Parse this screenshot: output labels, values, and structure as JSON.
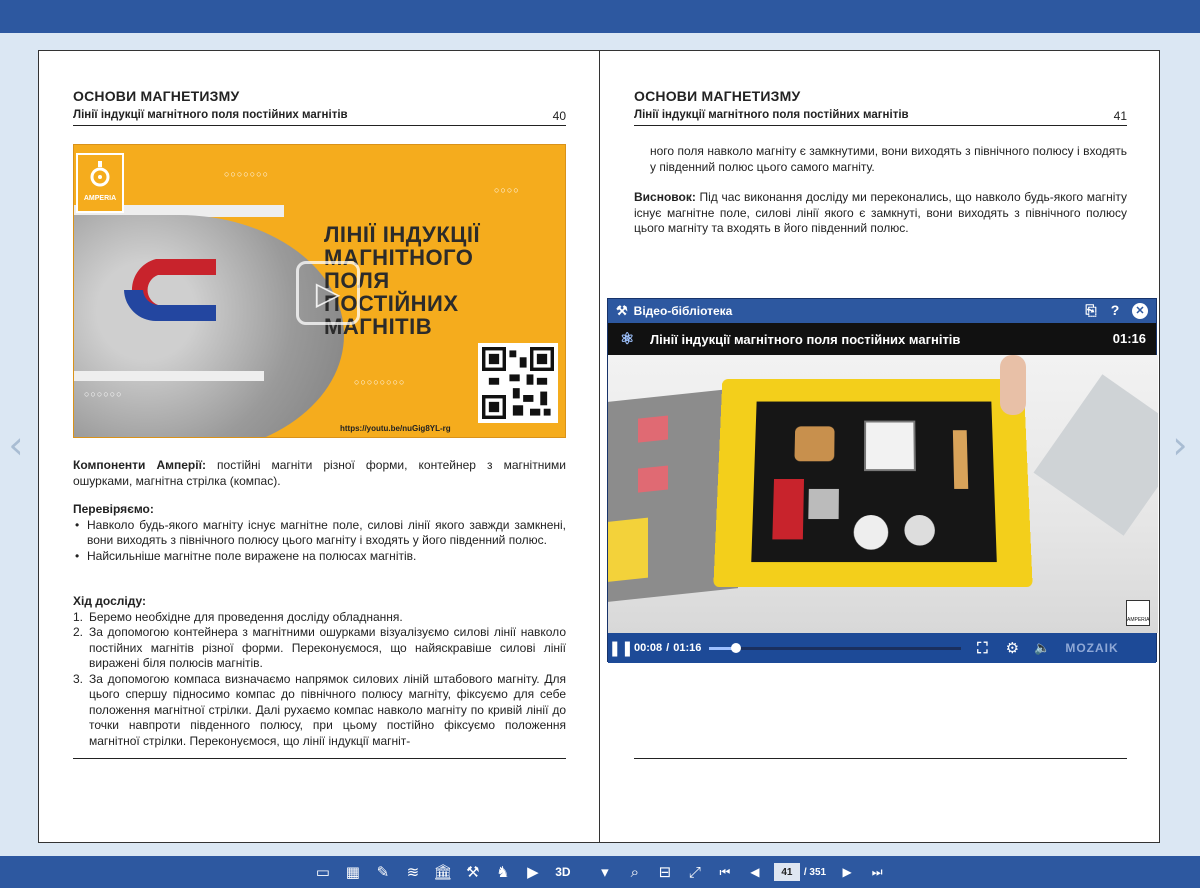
{
  "left_page": {
    "chapter": "ОСНОВИ МАГНЕТИЗМУ",
    "subtitle": "Лінії індукції магнітного поля постійних магнітів",
    "page_number": "40",
    "banner": {
      "brand": "AMPERIA",
      "title_lines": [
        "ЛІНІЇ ІНДУКЦІЇ",
        "МАГНІТНОГО",
        "ПОЛЯ",
        "ПОСТІЙНИХ",
        "МАГНІТІВ"
      ],
      "url": "https://youtu.be/nuGig8YL-rg"
    },
    "components_label": "Компоненти Амперії:",
    "components_text": " постійні магніти різної форми, контейнер з магнітними ошурками, магнітна стрілка (компас).",
    "check_heading": "Перевіряємо:",
    "check_items": [
      "Навколо будь-якого магніту існує магнітне поле, силові лінії якого завжди замкнені, вони виходять з північного полюсу цього магніту і входять у його південний полюс.",
      "Найсильніше магнітне поле виражене на полюсах магнітів."
    ],
    "procedure_heading": "Хід досліду:",
    "procedure_steps": [
      {
        "n": "1.",
        "text": "Беремо необхідне для проведення досліду обладнання."
      },
      {
        "n": "2.",
        "text": "За допомогою контейнера з магнітними ошурками візуалізуємо силові лінії навколо постійних магнітів різної форми. Переконуємося, що найяскравіше силові лінії виражені біля полюсів магнітів."
      },
      {
        "n": "3.",
        "text": "За допомогою компаса визначаємо напрямок силових ліній штабового магніту. Для цього спершу підносимо компас до північного полюсу магніту, фіксуємо для себе положення магнітної стрілки. Далі рухаємо компас навколо магніту по кривій лінії до точки навпроти південного полюсу, при цьому постійно фіксуємо положення магнітної стрілки. Переконуємося, що лінії індукції магніт-"
      }
    ]
  },
  "right_page": {
    "chapter": "ОСНОВИ МАГНЕТИЗМУ",
    "subtitle": "Лінії індукції магнітного поля постійних магнітів",
    "page_number": "41",
    "continuation": "ного поля навколо магніту є замкнутими, вони виходять з північного полюсу і входять у південний полюс цього самого магніту.",
    "conclusion_label": "Висновок:",
    "conclusion_text": " Під час виконання досліду ми переконались, що навколо будь-якого магніту існує магнітне поле, силові лінії якого є замкнуті, вони виходять з північного полюсу цього магніту та входять в його південний полюс."
  },
  "video_window": {
    "title": "Відео-бібліотека",
    "video_title": "Лінії індукції магнітного поля постійних магнітів",
    "duration": "01:16",
    "elapsed": "00:08",
    "total": "01:16",
    "progress": 0.105,
    "brand": "MOZAIK",
    "corner_brand": "AMPERIA"
  },
  "toolbar": {
    "current_page": "41",
    "total_pages": "/ 351"
  },
  "colors": {
    "bar_blue": "#2d58a0",
    "banner_orange": "#f5ac1d",
    "video_frame": "#1c3f7e"
  }
}
